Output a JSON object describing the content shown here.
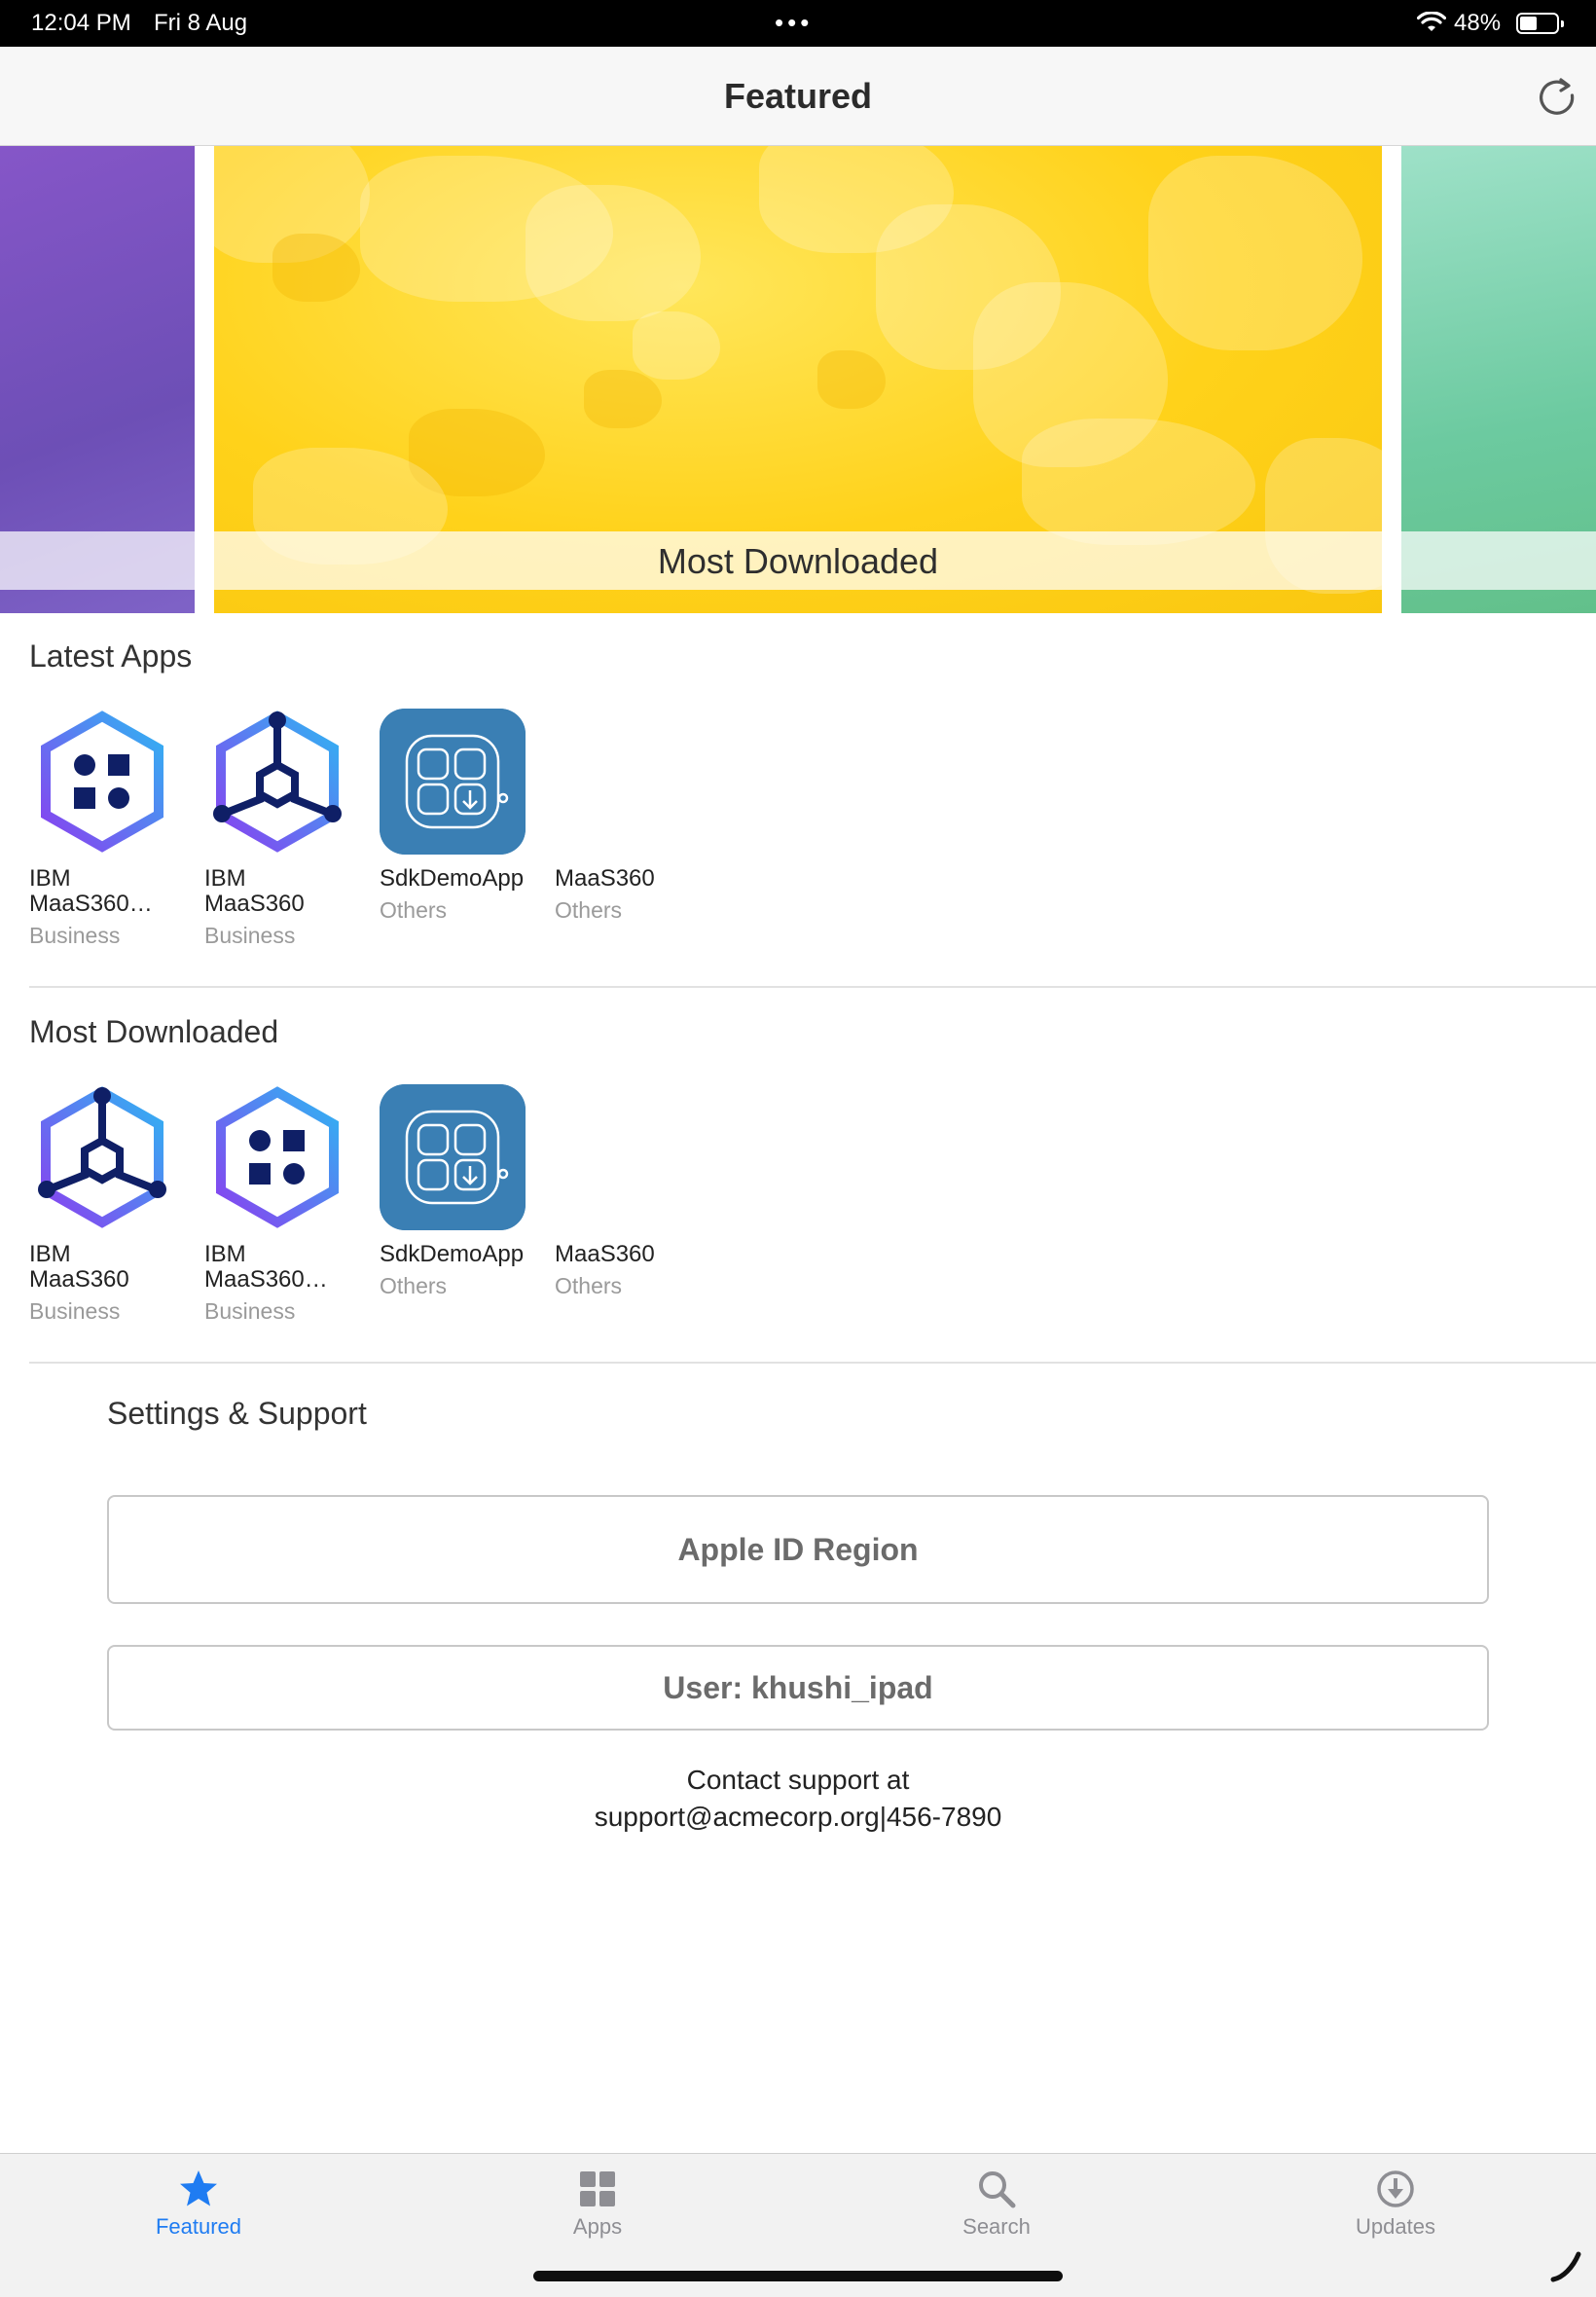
{
  "status_bar": {
    "time": "12:04 PM",
    "date": "Fri 8 Aug",
    "battery_percent": "48%",
    "battery_level": 0.48
  },
  "nav": {
    "title": "Featured",
    "refresh_icon": "refresh-icon"
  },
  "banner": {
    "label": "Most Downloaded"
  },
  "latest_apps": {
    "title": "Latest Apps",
    "apps": [
      {
        "name_line1": "IBM",
        "name_line2": "MaaS360…",
        "category": "Business",
        "icon": "maas360-grid-hex-icon"
      },
      {
        "name_line1": "IBM",
        "name_line2": "MaaS360",
        "category": "Business",
        "icon": "maas360-network-hex-icon"
      },
      {
        "name_line1": "SdkDemoApp",
        "name_line2": "",
        "category": "Others",
        "icon": "sdk-demo-app-icon"
      },
      {
        "name_line1": "MaaS360",
        "name_line2": "",
        "category": "Others",
        "icon": ""
      }
    ]
  },
  "most_downloaded": {
    "title": "Most Downloaded",
    "apps": [
      {
        "name_line1": "IBM",
        "name_line2": "MaaS360",
        "category": "Business",
        "icon": "maas360-network-hex-icon"
      },
      {
        "name_line1": "IBM",
        "name_line2": "MaaS360…",
        "category": "Business",
        "icon": "maas360-grid-hex-icon"
      },
      {
        "name_line1": "SdkDemoApp",
        "name_line2": "",
        "category": "Others",
        "icon": "sdk-demo-app-icon"
      },
      {
        "name_line1": "MaaS360",
        "name_line2": "",
        "category": "Others",
        "icon": ""
      }
    ]
  },
  "settings": {
    "title": "Settings & Support",
    "apple_id_label": "Apple ID Region",
    "user_label": "User: khushi_ipad",
    "contact_line1": "Contact support at",
    "contact_line2": "support@acmecorp.org|456-7890"
  },
  "tab_bar": {
    "tabs": [
      {
        "label": "Featured",
        "icon": "star-icon",
        "active": true
      },
      {
        "label": "Apps",
        "icon": "grid-icon",
        "active": false
      },
      {
        "label": "Search",
        "icon": "search-icon",
        "active": false
      },
      {
        "label": "Updates",
        "icon": "download-circle-icon",
        "active": false
      }
    ]
  },
  "colors": {
    "accent": "#1f7cf2",
    "sdk_icon_bg": "#3a7fb4",
    "banner_main": "#ffd21a",
    "hex_gradient_start": "#2fb5f2",
    "hex_gradient_end": "#8a3ff0",
    "maas_dark": "#0f1f66"
  }
}
